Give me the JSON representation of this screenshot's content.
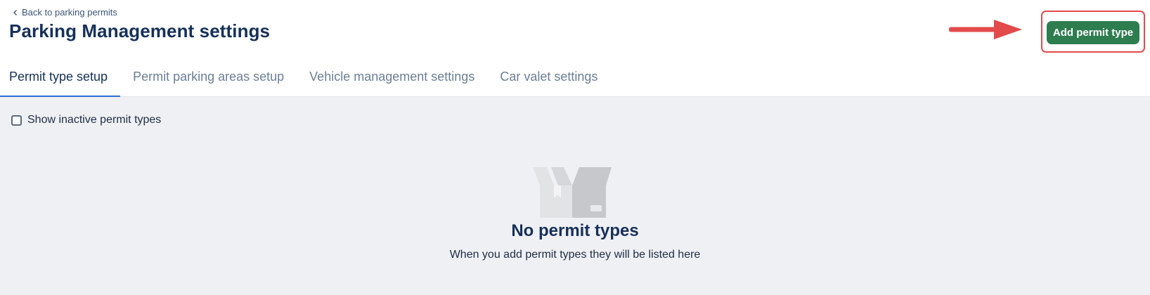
{
  "header": {
    "back_link": "Back to parking permits",
    "title": "Parking Management settings",
    "add_button": "Add permit type"
  },
  "tabs": [
    {
      "label": "Permit type setup",
      "active": true
    },
    {
      "label": "Permit parking areas setup",
      "active": false
    },
    {
      "label": "Vehicle management settings",
      "active": false
    },
    {
      "label": "Car valet settings",
      "active": false
    }
  ],
  "filters": {
    "show_inactive_label": "Show inactive permit types",
    "show_inactive_checked": false
  },
  "empty_state": {
    "icon": "empty-box-icon",
    "title": "No permit types",
    "subtitle": "When you add permit types they will be listed here"
  },
  "annotation": {
    "arrow_color": "#e34a4a",
    "highlight_color": "#e34a4a"
  },
  "colors": {
    "primary_button": "#2e7d4f",
    "active_tab_underline": "#2f6bd8",
    "title_text": "#16305a",
    "content_bg": "#eff0f3"
  }
}
